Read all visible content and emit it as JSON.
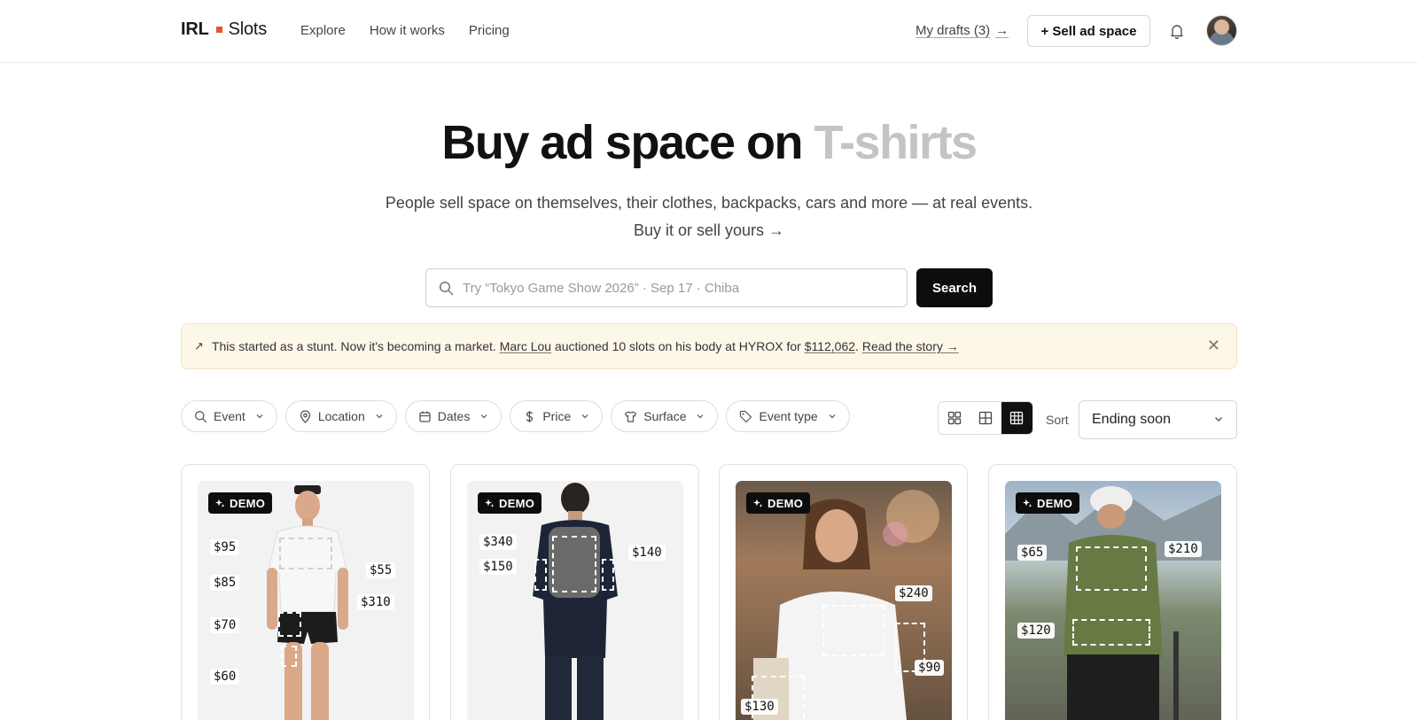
{
  "nav": {
    "logo_left": "IRL",
    "logo_right": "Slots",
    "links": [
      "Explore",
      "How it works",
      "Pricing"
    ],
    "drafts": "My drafts (3)",
    "drafts_arrow": "→",
    "sell_button": "+ Sell ad space"
  },
  "hero": {
    "title_main": "Buy ad space on",
    "title_accent": "T-shirts",
    "subtitle": "People sell space on themselves, their clothes, backpacks, cars and more — at real events.",
    "link": "Buy it or sell yours →"
  },
  "search": {
    "placeholder": "Try “Tokyo Game Show 2026” · Sep 17 · Chiba",
    "button": "Search"
  },
  "banner": {
    "icon": "↗",
    "text_before": "This started as a stunt. Now it's becoming a market.",
    "person": "Marc Lou",
    "text_middle": "auctioned 10 slots on his body at HYROX for",
    "amount": "$112,062",
    "period": ".",
    "link": "Read the story →",
    "close": "✕"
  },
  "filters": [
    "Event",
    "Location",
    "Dates",
    "Price",
    "Surface",
    "Event type"
  ],
  "sort": {
    "label": "Sort",
    "value": "Ending soon"
  },
  "cards": [
    {
      "badge": "DEMO",
      "prices": [
        "$95",
        "$85",
        "$70",
        "$60",
        "$55",
        "$310"
      ]
    },
    {
      "badge": "DEMO",
      "prices": [
        "$340",
        "$150",
        "$140"
      ]
    },
    {
      "badge": "DEMO",
      "prices": [
        "$240",
        "$90",
        "$130"
      ]
    },
    {
      "badge": "DEMO",
      "prices": [
        "$65",
        "$210",
        "$120"
      ]
    }
  ],
  "colors": {
    "accent": "#e8542d",
    "banner_bg": "#fdf7e8",
    "primary_button": "#0d0d0d"
  }
}
